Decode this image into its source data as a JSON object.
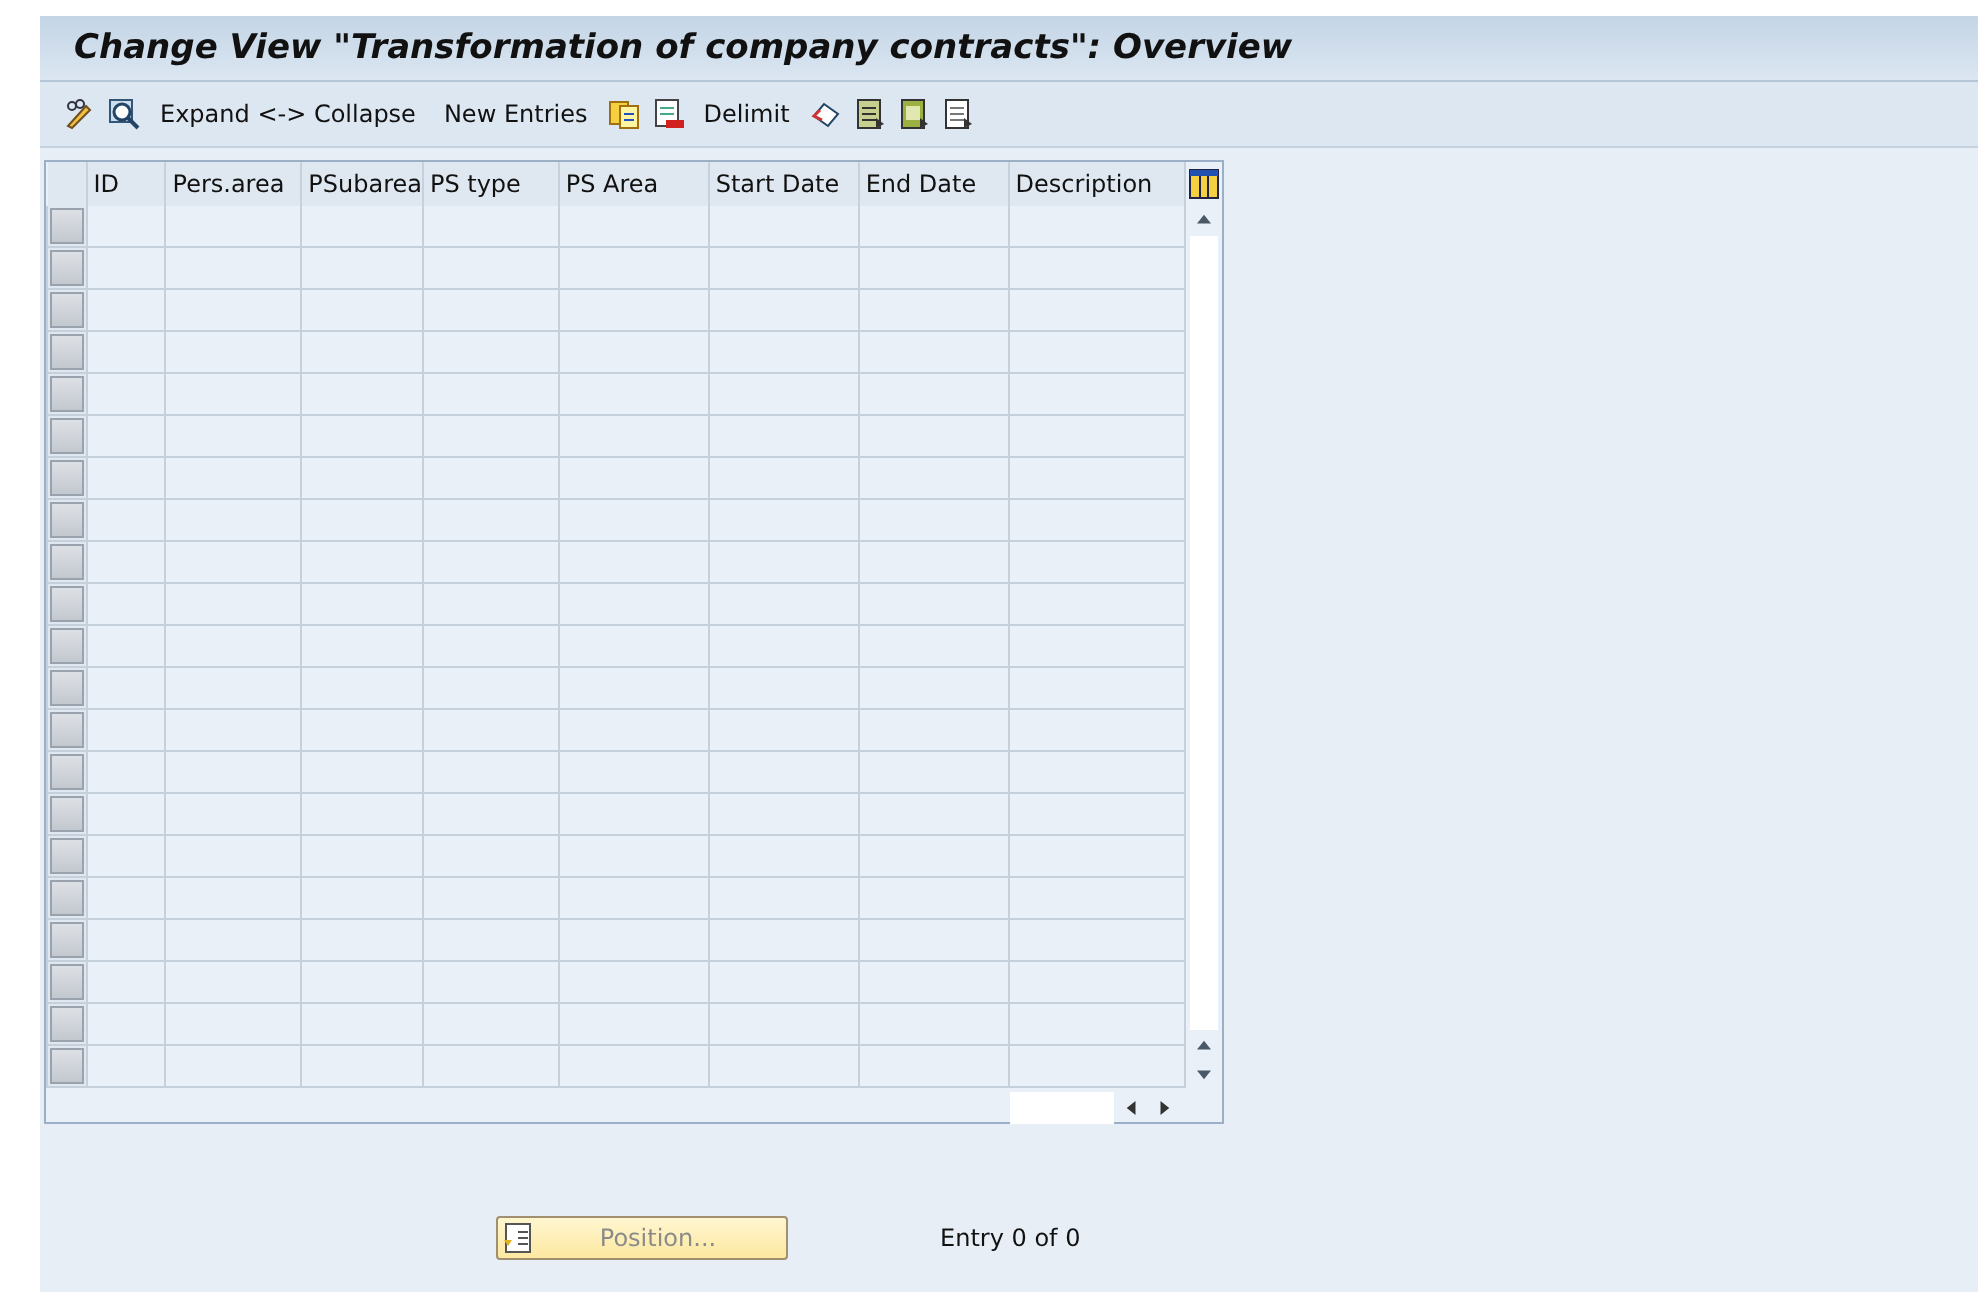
{
  "window": {
    "title": "Change View \"Transformation of company contracts\": Overview"
  },
  "toolbar": [
    {
      "kind": "icon"
    },
    {
      "kind": "icon"
    },
    {
      "kind": "text",
      "label": "Expand <-> Collapse"
    },
    {
      "kind": "text",
      "label": "New Entries"
    },
    {
      "kind": "icon"
    },
    {
      "kind": "icon"
    },
    {
      "kind": "text",
      "label": "Delimit"
    },
    {
      "kind": "icon"
    },
    {
      "kind": "icon"
    },
    {
      "kind": "icon"
    },
    {
      "kind": "icon"
    }
  ],
  "table": {
    "columns": [
      "ID",
      "Pers.area",
      "PSubarea",
      "PS type",
      "PS Area",
      "Start Date",
      "End Date",
      "Description"
    ],
    "rows": [
      {
        "selected": false
      },
      {
        "selected": false
      },
      {
        "selected": false
      },
      {
        "selected": false
      },
      {
        "selected": false
      },
      {
        "selected": false
      },
      {
        "selected": false
      },
      {
        "selected": false
      },
      {
        "selected": false
      },
      {
        "selected": false
      },
      {
        "selected": false
      },
      {
        "selected": false
      },
      {
        "selected": false
      },
      {
        "selected": false
      },
      {
        "selected": false
      },
      {
        "selected": false
      },
      {
        "selected": false
      },
      {
        "selected": false
      },
      {
        "selected": false
      },
      {
        "selected": false
      },
      {
        "selected": false
      }
    ]
  },
  "footer": {
    "position_button": {
      "label": "Position...",
      "disabled": true
    },
    "entry_info": "Entry 0 of 0"
  }
}
